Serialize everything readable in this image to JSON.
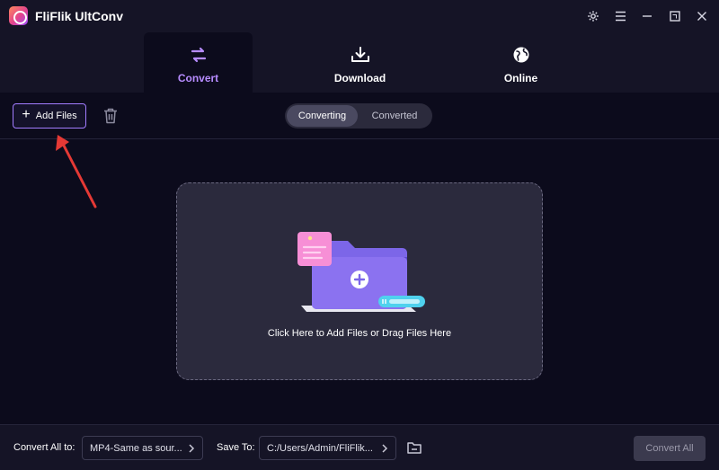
{
  "app": {
    "title": "FliFlik UltConv"
  },
  "nav": {
    "tabs": [
      {
        "label": "Convert",
        "icon": "swap-arrows-icon",
        "active": true
      },
      {
        "label": "Download",
        "icon": "download-icon",
        "active": false
      },
      {
        "label": "Online",
        "icon": "globe-icon",
        "active": false
      }
    ]
  },
  "toolbar": {
    "add_files_label": "Add Files",
    "segments": [
      {
        "label": "Converting",
        "selected": true
      },
      {
        "label": "Converted",
        "selected": false
      }
    ]
  },
  "dropzone": {
    "text": "Click Here to Add Files or Drag Files Here"
  },
  "bottom": {
    "convert_all_to_label": "Convert All to:",
    "format_value": "MP4-Same as sour...",
    "save_to_label": "Save To:",
    "save_path_value": "C:/Users/Admin/FliFlik...",
    "convert_all_button": "Convert All"
  },
  "colors": {
    "accent": "#b78cff",
    "background": "#0c0b1c",
    "titlebar": "#151426",
    "annotation_arrow": "#e53935"
  }
}
